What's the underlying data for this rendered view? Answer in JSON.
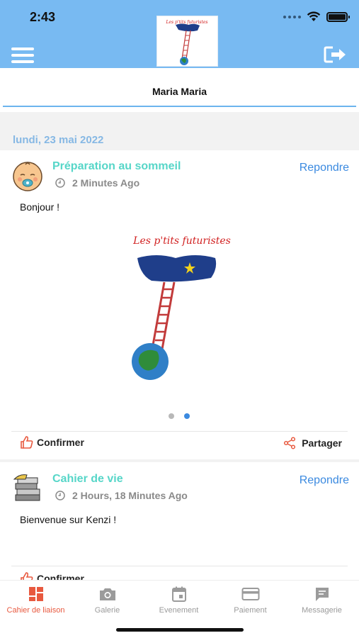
{
  "status_bar": {
    "time": "2:43"
  },
  "header": {
    "menu_icon": "hamburger-menu-icon",
    "logout_icon": "logout-icon",
    "logo_text": "Les p'tits futuristes",
    "brand_color": "#78baf2"
  },
  "child": {
    "name": "Maria Maria"
  },
  "feed": {
    "date": "lundi, 23 mai 2022",
    "posts": [
      {
        "title": "Préparation au sommeil",
        "time": "2 Minutes Ago",
        "reply_label": "Repondre",
        "body": "Bonjour !",
        "image_text": "Les p'tits futuristes",
        "carousel_total": 2,
        "carousel_active": 2,
        "confirm_label": "Confirmer",
        "share_label": "Partager"
      },
      {
        "title": "Cahier de vie",
        "time": "2 Hours, 18 Minutes Ago",
        "reply_label": "Repondre",
        "body": "Bienvenue sur Kenzi !",
        "confirm_label": "Confirmer"
      }
    ]
  },
  "tabs": [
    {
      "label": "Cahier de liaison",
      "icon": "dashboard-icon",
      "active": true
    },
    {
      "label": "Galerie",
      "icon": "camera-icon",
      "active": false
    },
    {
      "label": "Evenement",
      "icon": "calendar-icon",
      "active": false
    },
    {
      "label": "Paiement",
      "icon": "credit-card-icon",
      "active": false
    },
    {
      "label": "Messagerie",
      "icon": "message-icon",
      "active": false
    }
  ],
  "colors": {
    "accent_active_tab": "#e8593f",
    "post_title": "#56d6c8",
    "link": "#3b8ae0",
    "date": "#86b8e4"
  }
}
